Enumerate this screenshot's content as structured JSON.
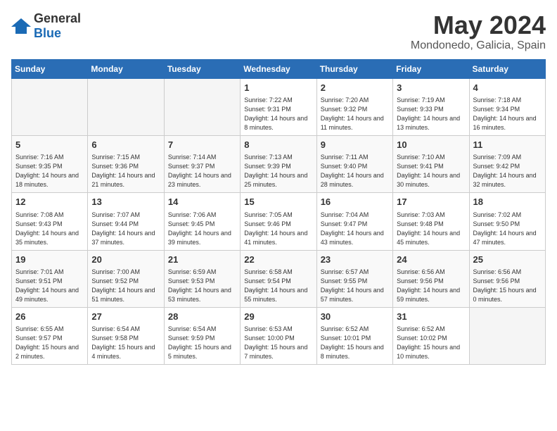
{
  "header": {
    "logo": {
      "text1": "General",
      "text2": "Blue"
    },
    "title": "May 2024",
    "location": "Mondonedo, Galicia, Spain"
  },
  "weekdays": [
    "Sunday",
    "Monday",
    "Tuesday",
    "Wednesday",
    "Thursday",
    "Friday",
    "Saturday"
  ],
  "weeks": [
    [
      {
        "day": "",
        "empty": true
      },
      {
        "day": "",
        "empty": true
      },
      {
        "day": "",
        "empty": true
      },
      {
        "day": "1",
        "sunrise": "7:22 AM",
        "sunset": "9:31 PM",
        "daylight": "14 hours and 8 minutes."
      },
      {
        "day": "2",
        "sunrise": "7:20 AM",
        "sunset": "9:32 PM",
        "daylight": "14 hours and 11 minutes."
      },
      {
        "day": "3",
        "sunrise": "7:19 AM",
        "sunset": "9:33 PM",
        "daylight": "14 hours and 13 minutes."
      },
      {
        "day": "4",
        "sunrise": "7:18 AM",
        "sunset": "9:34 PM",
        "daylight": "14 hours and 16 minutes."
      }
    ],
    [
      {
        "day": "5",
        "sunrise": "7:16 AM",
        "sunset": "9:35 PM",
        "daylight": "14 hours and 18 minutes."
      },
      {
        "day": "6",
        "sunrise": "7:15 AM",
        "sunset": "9:36 PM",
        "daylight": "14 hours and 21 minutes."
      },
      {
        "day": "7",
        "sunrise": "7:14 AM",
        "sunset": "9:37 PM",
        "daylight": "14 hours and 23 minutes."
      },
      {
        "day": "8",
        "sunrise": "7:13 AM",
        "sunset": "9:39 PM",
        "daylight": "14 hours and 25 minutes."
      },
      {
        "day": "9",
        "sunrise": "7:11 AM",
        "sunset": "9:40 PM",
        "daylight": "14 hours and 28 minutes."
      },
      {
        "day": "10",
        "sunrise": "7:10 AM",
        "sunset": "9:41 PM",
        "daylight": "14 hours and 30 minutes."
      },
      {
        "day": "11",
        "sunrise": "7:09 AM",
        "sunset": "9:42 PM",
        "daylight": "14 hours and 32 minutes."
      }
    ],
    [
      {
        "day": "12",
        "sunrise": "7:08 AM",
        "sunset": "9:43 PM",
        "daylight": "14 hours and 35 minutes."
      },
      {
        "day": "13",
        "sunrise": "7:07 AM",
        "sunset": "9:44 PM",
        "daylight": "14 hours and 37 minutes."
      },
      {
        "day": "14",
        "sunrise": "7:06 AM",
        "sunset": "9:45 PM",
        "daylight": "14 hours and 39 minutes."
      },
      {
        "day": "15",
        "sunrise": "7:05 AM",
        "sunset": "9:46 PM",
        "daylight": "14 hours and 41 minutes."
      },
      {
        "day": "16",
        "sunrise": "7:04 AM",
        "sunset": "9:47 PM",
        "daylight": "14 hours and 43 minutes."
      },
      {
        "day": "17",
        "sunrise": "7:03 AM",
        "sunset": "9:48 PM",
        "daylight": "14 hours and 45 minutes."
      },
      {
        "day": "18",
        "sunrise": "7:02 AM",
        "sunset": "9:50 PM",
        "daylight": "14 hours and 47 minutes."
      }
    ],
    [
      {
        "day": "19",
        "sunrise": "7:01 AM",
        "sunset": "9:51 PM",
        "daylight": "14 hours and 49 minutes."
      },
      {
        "day": "20",
        "sunrise": "7:00 AM",
        "sunset": "9:52 PM",
        "daylight": "14 hours and 51 minutes."
      },
      {
        "day": "21",
        "sunrise": "6:59 AM",
        "sunset": "9:53 PM",
        "daylight": "14 hours and 53 minutes."
      },
      {
        "day": "22",
        "sunrise": "6:58 AM",
        "sunset": "9:54 PM",
        "daylight": "14 hours and 55 minutes."
      },
      {
        "day": "23",
        "sunrise": "6:57 AM",
        "sunset": "9:55 PM",
        "daylight": "14 hours and 57 minutes."
      },
      {
        "day": "24",
        "sunrise": "6:56 AM",
        "sunset": "9:56 PM",
        "daylight": "14 hours and 59 minutes."
      },
      {
        "day": "25",
        "sunrise": "6:56 AM",
        "sunset": "9:56 PM",
        "daylight": "15 hours and 0 minutes."
      }
    ],
    [
      {
        "day": "26",
        "sunrise": "6:55 AM",
        "sunset": "9:57 PM",
        "daylight": "15 hours and 2 minutes."
      },
      {
        "day": "27",
        "sunrise": "6:54 AM",
        "sunset": "9:58 PM",
        "daylight": "15 hours and 4 minutes."
      },
      {
        "day": "28",
        "sunrise": "6:54 AM",
        "sunset": "9:59 PM",
        "daylight": "15 hours and 5 minutes."
      },
      {
        "day": "29",
        "sunrise": "6:53 AM",
        "sunset": "10:00 PM",
        "daylight": "15 hours and 7 minutes."
      },
      {
        "day": "30",
        "sunrise": "6:52 AM",
        "sunset": "10:01 PM",
        "daylight": "15 hours and 8 minutes."
      },
      {
        "day": "31",
        "sunrise": "6:52 AM",
        "sunset": "10:02 PM",
        "daylight": "15 hours and 10 minutes."
      },
      {
        "day": "",
        "empty": true
      }
    ]
  ]
}
